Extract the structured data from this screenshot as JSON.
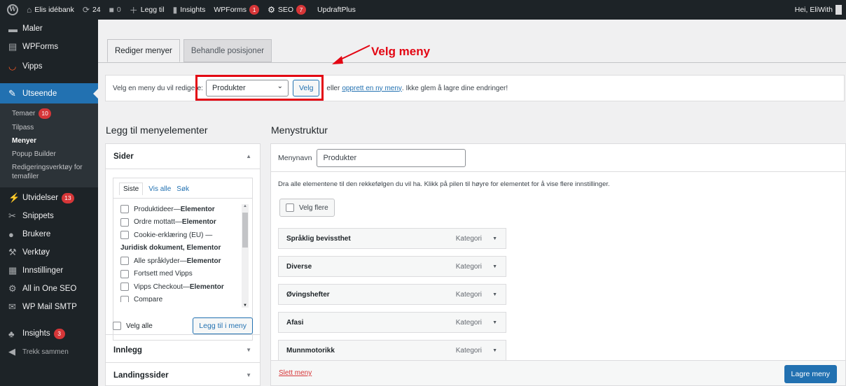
{
  "adminbar": {
    "site_name": "Elis idébank",
    "updates_count": "24",
    "comments_count": "0",
    "new_label": "Legg til",
    "insights_label": "Insights",
    "wpforms_label": "WPForms",
    "wpforms_badge": "1",
    "seo_label": "SEO",
    "seo_badge": "7",
    "updraft_label": "UpdraftPlus",
    "greeting": "Hei, EliWith"
  },
  "sidebar": {
    "maler": "Maler",
    "wpforms": "WPForms",
    "vipps": "Vipps",
    "utseende": "Utseende",
    "sub": {
      "temaer": "Temaer",
      "temaer_badge": "10",
      "tilpass": "Tilpass",
      "menyer": "Menyer",
      "popup": "Popup Builder",
      "redigering": "Redigeringsverktøy for temafiler"
    },
    "utvidelser": "Utvidelser",
    "utvidelser_badge": "13",
    "snippets": "Snippets",
    "brukere": "Brukere",
    "verktoy": "Verktøy",
    "innstillinger": "Innstillinger",
    "aioseo": "All in One SEO",
    "wpmail": "WP Mail SMTP",
    "insights": "Insights",
    "insights_badge": "3",
    "trekk": "Trekk sammen"
  },
  "tabs": {
    "edit": "Rediger menyer",
    "locations": "Behandle posisjoner"
  },
  "select_bar": {
    "prompt": "Velg en meny du vil rediger",
    "prompt_tail": "e:",
    "selected_menu": "Produkter",
    "button": "Velg",
    "text_before_link": "eller",
    "link": "opprett en ny meny",
    "text_after_link": ". Ikke glem å lagre dine endringer!"
  },
  "annotation": {
    "text": "Velg meny"
  },
  "left": {
    "heading": "Legg til menyelementer",
    "sider": "Sider",
    "inner_tabs": [
      "Siste",
      "Vis alle",
      "Søk"
    ],
    "pages": [
      {
        "title": "Produktideer",
        "suffix": "Elementor",
        "checkbox": true
      },
      {
        "title": "Ordre mottatt",
        "suffix": "Elementor",
        "checkbox": true
      },
      {
        "title": "Cookie-erklæring (EU) —",
        "suffix": "",
        "checkbox": true
      },
      {
        "title": "Juridisk dokument, Elementor",
        "suffix": "",
        "checkbox": false
      },
      {
        "title": "Alle språklyder",
        "suffix": "Elementor",
        "checkbox": true
      },
      {
        "title": "Fortsett med Vipps",
        "suffix": "",
        "checkbox": true
      },
      {
        "title": "Vipps Checkout",
        "suffix": "Elementor",
        "checkbox": true
      },
      {
        "title": "Compare",
        "suffix": "",
        "checkbox": true
      }
    ],
    "select_all": "Velg alle",
    "add_button": "Legg til i meny",
    "innlegg": "Innlegg",
    "landingssider": "Landingssider"
  },
  "right": {
    "heading": "Menystruktur",
    "name_label": "Menynavn",
    "name_value": "Produkter",
    "description": "Dra alle elementene til den rekkefølgen du vil ha. Klikk på pilen til høyre for elementet for å vise flere innstillinger.",
    "bulk_select": "Velg flere",
    "items": [
      {
        "title": "Språklig bevissthet",
        "type": "Kategori"
      },
      {
        "title": "Diverse",
        "type": "Kategori"
      },
      {
        "title": "Øvingshefter",
        "type": "Kategori"
      },
      {
        "title": "Afasi",
        "type": "Kategori"
      },
      {
        "title": "Munnmotorikk",
        "type": "Kategori"
      }
    ],
    "delete_link": "Slett meny",
    "save_button": "Lagre meny"
  }
}
